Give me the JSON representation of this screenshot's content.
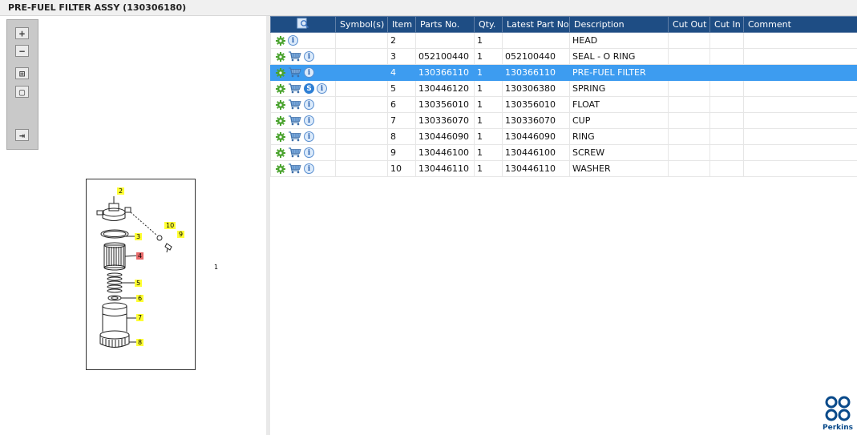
{
  "window": {
    "title": "PRE-FUEL FILTER ASSY (130306180)"
  },
  "toolbar": {
    "buttons": [
      {
        "name": "zoom-in",
        "glyph": "+"
      },
      {
        "name": "zoom-out",
        "glyph": "−"
      },
      {
        "name": "fit",
        "glyph": "⊞"
      },
      {
        "name": "actual-size",
        "glyph": "▢"
      },
      {
        "name": "export",
        "glyph": "⇥"
      }
    ]
  },
  "drawing": {
    "assembly_label": "1",
    "callouts": [
      {
        "label": "2",
        "selected": false
      },
      {
        "label": "10",
        "selected": false
      },
      {
        "label": "9",
        "selected": false
      },
      {
        "label": "3",
        "selected": false
      },
      {
        "label": "4",
        "selected": true
      },
      {
        "label": "5",
        "selected": false
      },
      {
        "label": "6",
        "selected": false
      },
      {
        "label": "7",
        "selected": false
      },
      {
        "label": "8",
        "selected": false
      }
    ]
  },
  "grid": {
    "columns": [
      "",
      "Symbol(s)",
      "Item",
      "Parts No.",
      "Qty.",
      "Latest Part No.",
      "Description",
      "Cut Out",
      "Cut In",
      "Comment"
    ],
    "rows": [
      {
        "item": "2",
        "parts_no": "",
        "qty": "1",
        "latest": "",
        "description": "HEAD",
        "cart": false,
        "symbol": false,
        "selected": false
      },
      {
        "item": "3",
        "parts_no": "052100440",
        "qty": "1",
        "latest": "052100440",
        "description": "SEAL - O RING",
        "cart": true,
        "symbol": false,
        "selected": false
      },
      {
        "item": "4",
        "parts_no": "130366110",
        "qty": "1",
        "latest": "130366110",
        "description": "PRE-FUEL FILTER",
        "cart": true,
        "symbol": false,
        "selected": true
      },
      {
        "item": "5",
        "parts_no": "130446120",
        "qty": "1",
        "latest": "130306380",
        "description": "SPRING",
        "cart": true,
        "symbol": true,
        "selected": false
      },
      {
        "item": "6",
        "parts_no": "130356010",
        "qty": "1",
        "latest": "130356010",
        "description": "FLOAT",
        "cart": true,
        "symbol": false,
        "selected": false
      },
      {
        "item": "7",
        "parts_no": "130336070",
        "qty": "1",
        "latest": "130336070",
        "description": "CUP",
        "cart": true,
        "symbol": false,
        "selected": false
      },
      {
        "item": "8",
        "parts_no": "130446090",
        "qty": "1",
        "latest": "130446090",
        "description": "RING",
        "cart": true,
        "symbol": false,
        "selected": false
      },
      {
        "item": "9",
        "parts_no": "130446100",
        "qty": "1",
        "latest": "130446100",
        "description": "SCREW",
        "cart": true,
        "symbol": false,
        "selected": false
      },
      {
        "item": "10",
        "parts_no": "130446110",
        "qty": "1",
        "latest": "130446110",
        "description": "WASHER",
        "cart": true,
        "symbol": false,
        "selected": false
      }
    ],
    "symbol_glyph": "S",
    "info_glyph": "i"
  },
  "icons": {
    "header": "search-list-icon",
    "gear": "gear-icon",
    "cart": "cart-icon",
    "info": "info-icon",
    "symbol": "symbol-s-icon"
  },
  "colors": {
    "header_bg": "#1e4d84",
    "selected_row": "#3d9cf0",
    "callout": "#ffff33",
    "callout_selected": "#e86a6a",
    "gear": "#4aa32e"
  },
  "brand": {
    "name": "Perkins"
  }
}
